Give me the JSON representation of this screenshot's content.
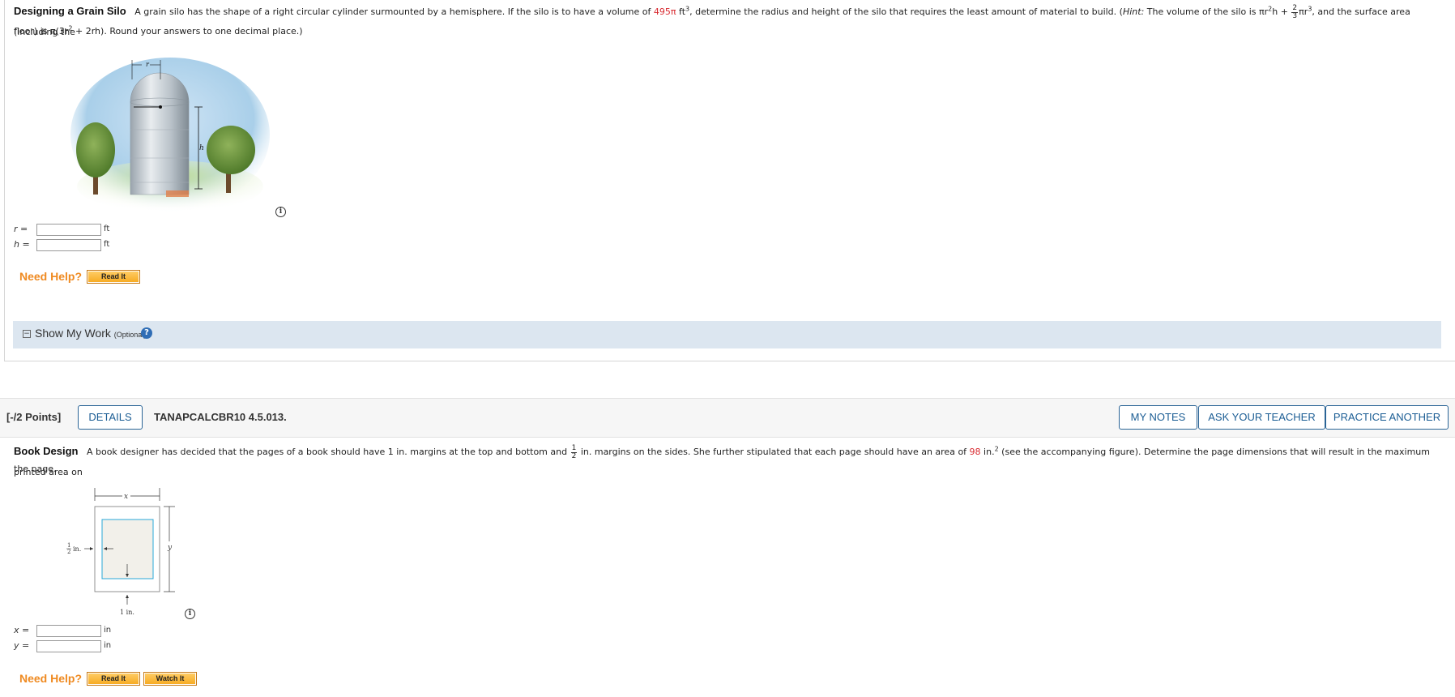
{
  "q1": {
    "title": "Designing a Grain Silo",
    "text_a": "A grain silo has the shape of a right circular cylinder surmounted by a hemisphere. If the silo is to have a volume of",
    "volume": "495π",
    "text_b": "ft",
    "text_c": ", determine the radius and height of the silo that requires the least amount of material to build. (",
    "hint_label": "Hint:",
    "text_d": "The volume of the silo is πr",
    "text_e": "h +",
    "frac_num": "2",
    "frac_den": "3",
    "text_f": "πr",
    "text_g": ", and the surface area (including the",
    "line2": "floor) is π(3r",
    "line2b": "+ 2rh). Round your answers to one decimal place.)",
    "figure_label_r": "r",
    "figure_label_h": "h",
    "answers": [
      {
        "var": "r",
        "eq": "=",
        "value": "",
        "unit": "ft"
      },
      {
        "var": "h",
        "eq": "=",
        "value": "",
        "unit": "ft"
      }
    ],
    "need_help": "Need Help?",
    "read_it": "Read It",
    "show_my_work": "Show My Work",
    "optional": "(Optional)",
    "toggle": "−",
    "help_q": "?"
  },
  "q2_header": {
    "points": "[-/2 Points]",
    "details": "DETAILS",
    "qid": "TANAPCALCBR10 4.5.013.",
    "my_notes": "MY NOTES",
    "ask_teacher": "ASK YOUR TEACHER",
    "practice": "PRACTICE ANOTHER"
  },
  "q2": {
    "title": "Book Design",
    "text_a": "A book designer has decided that the pages of a book should have 1 in. margins at the top and bottom and",
    "frac_num": "1",
    "frac_den": "2",
    "text_b": "in. margins on the sides. She further stipulated that each page should have an area of",
    "area": "98",
    "text_c": "in.",
    "text_d": "(see the accompanying figure). Determine the page dimensions that will result in the maximum printed area on",
    "line2": "the page.",
    "fig_x": "x",
    "fig_y": "y",
    "fig_half": "in.",
    "fig_half_num": "1",
    "fig_half_den": "2",
    "fig_one": "1 in.",
    "answers": [
      {
        "var": "x",
        "eq": "=",
        "value": "",
        "unit": "in"
      },
      {
        "var": "y",
        "eq": "=",
        "value": "",
        "unit": "in"
      }
    ],
    "need_help": "Need Help?",
    "read_it": "Read It",
    "watch_it": "Watch It"
  },
  "info_glyph": "i",
  "colors": {
    "accent_red": "#d8292f",
    "help_orange": "#ef8a21",
    "link_blue": "#1b5d94",
    "smw_bg": "#dce6f0"
  }
}
